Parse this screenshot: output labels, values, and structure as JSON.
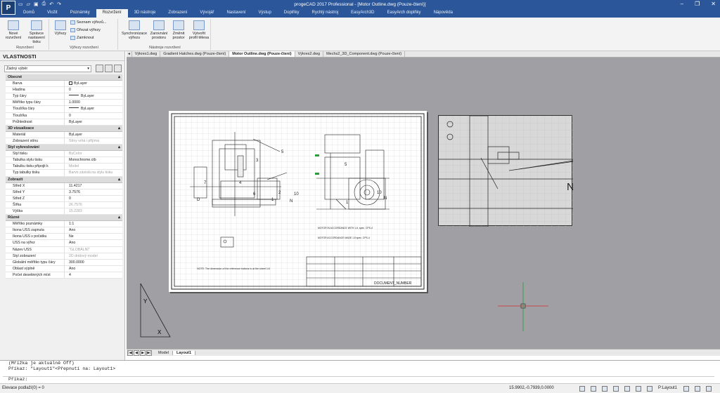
{
  "window": {
    "title": "progeCAD 2017 Professional - [Motor Outline.dwg (Pouze-čtení)]",
    "logo": "P",
    "qat_icons": [
      "new-icon",
      "open-icon",
      "save-icon",
      "print-icon",
      "undo-icon",
      "redo-icon"
    ],
    "controls": [
      "–",
      "❐",
      "✕"
    ]
  },
  "ribbon": {
    "tabs": [
      "Domů",
      "Vložit",
      "Poznámky",
      "Rozvržení",
      "3D nástroje",
      "Zobrazení",
      "Vývojář",
      "Nastavení",
      "Výstup",
      "Doplňky",
      "Rychlý nástroj",
      "EasyArch3D",
      "EasyArch doplňky",
      "Nápověda"
    ],
    "active_tab": "Rozvržení",
    "groups": {
      "rozvrzeni": {
        "label": "Rozvržení",
        "new_layout": "Nové rozvržení",
        "setup": "Správce nastavení tisku"
      },
      "vyrezy": {
        "label": "Výřezy rozvržení",
        "viewports": "Výřezy",
        "list": "Seznam výřezů...",
        "clip": "Ořezat výřezy",
        "lock": "Zamknout"
      },
      "nastroje": {
        "label": "Nástroje rozvržení",
        "sync": "Synchronizace výřezu",
        "align": "Zarovnání prostoru",
        "change": "Změnit prostor",
        "profile": "Vytvořit profil tělesa"
      }
    }
  },
  "properties": {
    "title": "VLASTNOSTI",
    "selection": "Žádný výběr",
    "categories": [
      {
        "name": "Obecné",
        "rows": [
          {
            "label": "Barva",
            "value": "ByLayer",
            "kind": "swatch"
          },
          {
            "label": "Hladina",
            "value": "0"
          },
          {
            "label": "Typ čáry",
            "value": "ByLayer",
            "kind": "line"
          },
          {
            "label": "Měřítko typu čáry",
            "value": "1.0000"
          },
          {
            "label": "Tloušťka čáry",
            "value": "ByLayer",
            "kind": "line"
          },
          {
            "label": "Tloušťka",
            "value": "0"
          },
          {
            "label": "Průhlednost",
            "value": "ByLayer"
          }
        ]
      },
      {
        "name": "3D vizualizace",
        "rows": [
          {
            "label": "Materiál",
            "value": "ByLayer"
          },
          {
            "label": "Zobrazení stínu",
            "value": "Stíny vrhá i přijímá",
            "dim": true
          }
        ]
      },
      {
        "name": "Styl vykreslování",
        "rows": [
          {
            "label": "Styl tisku",
            "value": "ByColor",
            "dim": true
          },
          {
            "label": "Tabulka stylu tisku",
            "value": "Monochrome.ctb"
          },
          {
            "label": "Tabulku tisku připojit k",
            "value": "Model",
            "dim": true
          },
          {
            "label": "Typ tabulky tisku",
            "value": "Barvo závislá na stylu tisku",
            "dim": true
          }
        ]
      },
      {
        "name": "Zobrazit",
        "rows": [
          {
            "label": "Střed X",
            "value": "11.4217"
          },
          {
            "label": "Střed Y",
            "value": "3.7576"
          },
          {
            "label": "Střed Z",
            "value": "0"
          },
          {
            "label": "Šířka",
            "value": "26.7576",
            "dim": true
          },
          {
            "label": "Výška",
            "value": "15.2283",
            "dim": true
          }
        ]
      },
      {
        "name": "Různé",
        "rows": [
          {
            "label": "Měřítko poznámky",
            "value": "1:1"
          },
          {
            "label": "Ikona USS zapnuta",
            "value": "Ano"
          },
          {
            "label": "Ikona USS v počátku",
            "value": "Ne"
          },
          {
            "label": "USS na výřez",
            "value": "Ano"
          },
          {
            "label": "Název USS",
            "value": "\"GLOBÁLNÍ\"",
            "dim": true
          },
          {
            "label": "Styl zobrazení",
            "value": "2D drátový model",
            "dim": true
          },
          {
            "label": "Globální měřítko typu čáry",
            "value": "300.0000"
          },
          {
            "label": "Oblast výplně",
            "value": "Ano"
          },
          {
            "label": "Počet desetinných míst",
            "value": "4"
          }
        ]
      }
    ]
  },
  "doc_tabs": [
    "Výkres1.dwg",
    "Gradient Hatches.dwg (Pouze-čtení)",
    "Motor Outline.dwg (Pouze-čtení)",
    "Výkres2.dwg",
    "Mechs2_3D_Component.dwg (Pouze-čtení)"
  ],
  "active_doc": "Motor Outline.dwg (Pouze-čtení)",
  "drawing": {
    "balloons": [
      "5",
      "3",
      "4",
      "2",
      "7",
      "10",
      "D",
      "N",
      "1",
      "6",
      "5",
      "10",
      "N",
      "1"
    ],
    "note": "NOTE: The dimension of the reference buttons is at the sheet 1/4",
    "motor_notes": [
      "MOTOR IN ACCORDANCE WITH 1.6, spec. CPS-4",
      "MOTOR ACCORDANCE MADE 1.8 spec. CPS-4"
    ],
    "title_block": "DOCUMENT_NUMBER",
    "detail_labels": {
      "balloon": "10",
      "letter": "N"
    }
  },
  "layout_tabs": {
    "nav": [
      "|◀",
      "◀",
      "▶",
      "▶|"
    ],
    "tabs": [
      "Model",
      "Layout1"
    ],
    "active": "Layout1"
  },
  "command": {
    "history": [
      "(Mřížka je aktuálně Off)",
      "Příkaz: \"Layout1\"<Přepnutí na: Layout1>"
    ],
    "prompt": "Příkaz:"
  },
  "status": {
    "left": "Elevace podlaží(0) = 0",
    "coords": "15.9902,-0.7939,0.0000",
    "layout": "P:Layout1"
  },
  "colors": {
    "brand": "#2b579a",
    "canvas": "#a0a0a4"
  }
}
